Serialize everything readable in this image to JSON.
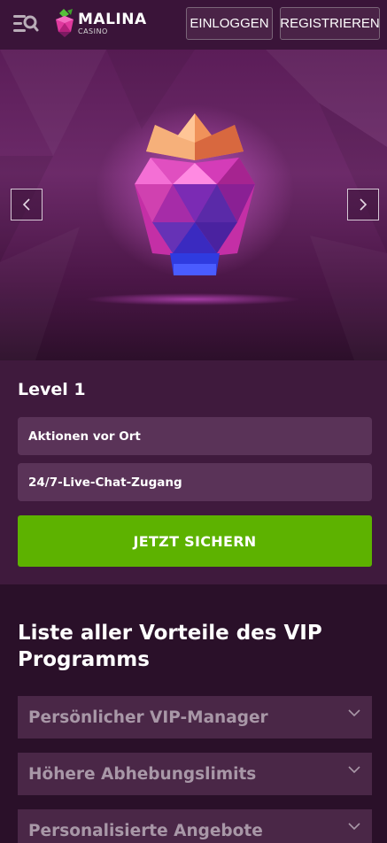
{
  "header": {
    "logo_text": "MALINA",
    "logo_sub": "CASINO",
    "login_label": "EINLOGGEN",
    "register_label": "REGISTRIEREN",
    "icons": [
      "menu-search-icon",
      "malina-logo-icon"
    ]
  },
  "hero": {
    "prev_icon": "chevron-left-icon",
    "next_icon": "chevron-right-icon",
    "image": "crowned-gem-icon"
  },
  "level": {
    "title": "Level 1",
    "perks": [
      "Aktionen vor Ort",
      "24/7-Live-Chat-Zugang"
    ],
    "cta_label": "JETZT SICHERN"
  },
  "benefits": {
    "title": "Liste aller Vorteile des VIP Programms",
    "items": [
      "Persönlicher VIP-Manager",
      "Höhere Abhebungslimits",
      "Personalisierte Angebote"
    ]
  },
  "colors": {
    "header_bg": "#3a1439",
    "section_bg": "#3f1a3d",
    "page_bg": "#2a1029",
    "perk_bg": "#5a3358",
    "accordion_bg": "#4a2747",
    "cta_green": "#5db200"
  }
}
